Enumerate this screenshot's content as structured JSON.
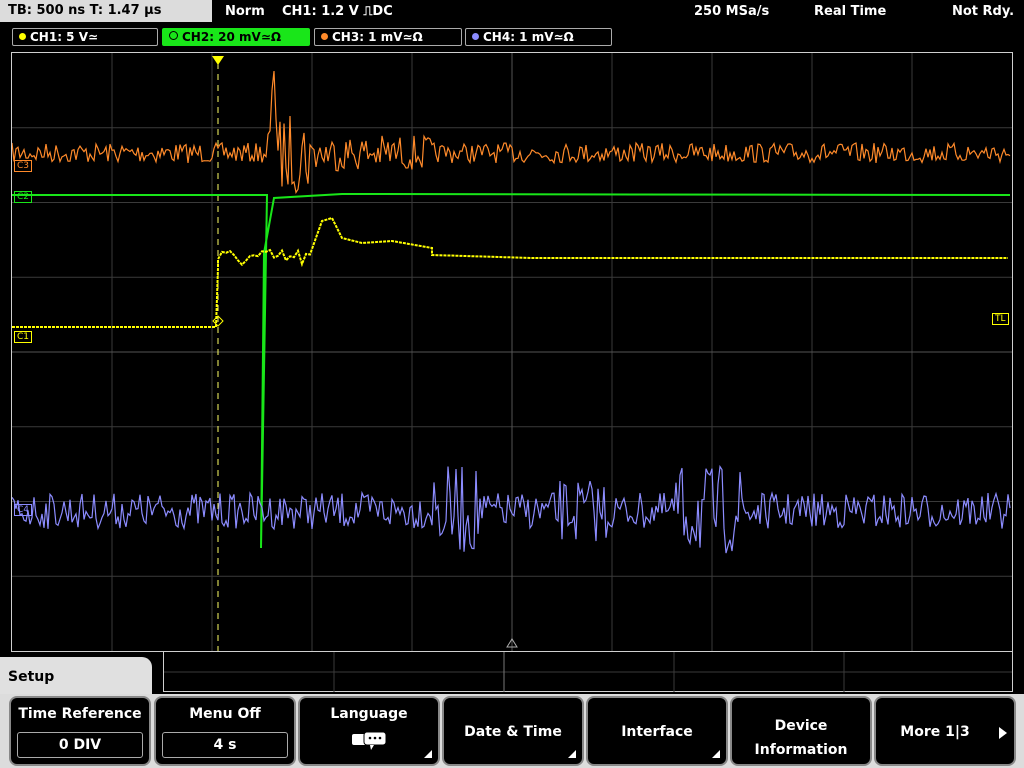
{
  "status": {
    "timebase": "TB: 500 ns   T: 1.47 µs",
    "mode": "Norm",
    "trigger": "CH1: 1.2 V ⎍DC",
    "sample_rate": "250 MSa/s",
    "acq_mode": "Real Time",
    "state": "Not Rdy."
  },
  "channels": [
    {
      "label": "CH1: 5 V≃",
      "color": "#ffff00"
    },
    {
      "label": "CH2: 20 mV≃Ω",
      "color": "#19e619"
    },
    {
      "label": "CH3: 1 mV≃Ω",
      "color": "#ff8a2a"
    },
    {
      "label": "CH4: 1 mV≃Ω",
      "color": "#8c8cff"
    }
  ],
  "markers": {
    "ch3": "C3",
    "ch2": "C2",
    "ch1": "C1",
    "ch4": "C4",
    "trigger_level": "TL"
  },
  "menu": {
    "title": "Setup",
    "keys": [
      {
        "label": "Time Reference",
        "value": "0 DIV"
      },
      {
        "label": "Menu Off",
        "value": "4 s"
      },
      {
        "label": "Language",
        "value": ""
      },
      {
        "label": "Date & Time",
        "value": ""
      },
      {
        "label": "Interface",
        "value": ""
      },
      {
        "label": "Device",
        "label2": "Information"
      },
      {
        "label": "More 1|3",
        "value": ""
      }
    ]
  },
  "icons": {
    "language": "speech-bubble-icon",
    "more": "arrow-right-icon",
    "trigger_pos": "trigger-position-icon"
  }
}
